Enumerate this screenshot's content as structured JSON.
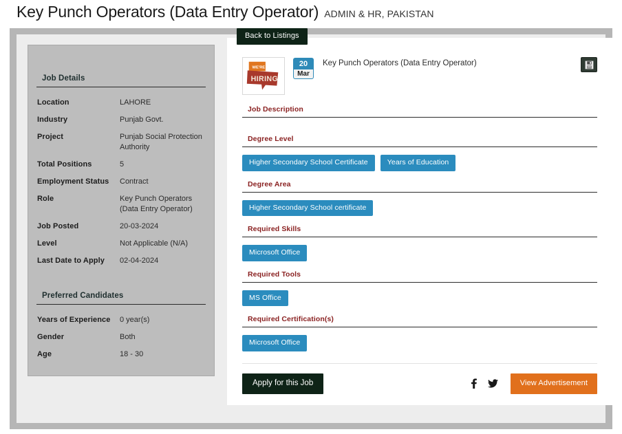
{
  "header": {
    "title": "Key Punch Operators (Data Entry Operator)",
    "subtitle": "ADMIN & HR, PAKISTAN"
  },
  "sidebar": {
    "job_details_title": "Job Details",
    "job_details": [
      {
        "label": "Location",
        "value": "LAHORE"
      },
      {
        "label": "Industry",
        "value": "Punjab Govt."
      },
      {
        "label": "Project",
        "value": "Punjab Social Protection Authority"
      },
      {
        "label": "Total Positions",
        "value": "5"
      },
      {
        "label": "Employment Status",
        "value": "Contract"
      },
      {
        "label": "Role",
        "value": "Key Punch Operators (Data Entry Operator)"
      },
      {
        "label": "Job Posted",
        "value": "20-03-2024"
      },
      {
        "label": "Level",
        "value": "Not Applicable (N/A)"
      },
      {
        "label": "Last Date to Apply",
        "value": "02-04-2024"
      }
    ],
    "preferred_title": "Preferred Candidates",
    "preferred": [
      {
        "label": "Years of Experience",
        "value": "0 year(s)"
      },
      {
        "label": "Gender",
        "value": "Both"
      },
      {
        "label": "Age",
        "value": "18 - 30"
      }
    ]
  },
  "main": {
    "back_label": "Back to Listings",
    "job_title": "Key Punch Operators (Data Entry Operator)",
    "date_badge": {
      "day": "20",
      "month": "Mar"
    },
    "thumbnail_alt": "We're HIRING",
    "save_icon": "save-icon",
    "sections": [
      {
        "heading": "Job Description",
        "tags": []
      },
      {
        "heading": "Degree Level",
        "tags": [
          "Higher Secondary School Certificate",
          "Years of Education"
        ]
      },
      {
        "heading": "Degree Area",
        "tags": [
          "Higher Secondary School certificate"
        ]
      },
      {
        "heading": "Required Skills",
        "tags": [
          "Microsoft Office"
        ]
      },
      {
        "heading": "Required Tools",
        "tags": [
          "MS Office"
        ]
      },
      {
        "heading": "Required Certification(s)",
        "tags": [
          "Microsoft Office"
        ]
      }
    ],
    "footer": {
      "apply_label": "Apply for this Job",
      "facebook_icon": "facebook-icon",
      "twitter_icon": "twitter-icon",
      "advertisement_label": "View Advertisement"
    }
  },
  "colors": {
    "accent_blue": "#2b8cbe",
    "heading_red": "#8a2121",
    "dark_green": "#0e2317",
    "orange": "#e1701c"
  }
}
